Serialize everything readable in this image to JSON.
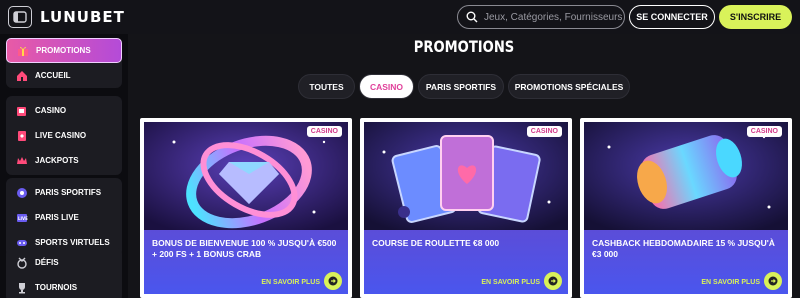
{
  "header": {
    "logo": "LUNUBET",
    "search_placeholder": "Jeux, Catégories, Fournisseurs",
    "login_label": "SE CONNECTER",
    "signup_label": "S'INSCRIRE",
    "colors": {
      "accent": "#d9f25a",
      "bg": "#131318"
    }
  },
  "sidebar": {
    "items": [
      {
        "label": "PROMOTIONS",
        "icon": "gift-icon",
        "active": true
      },
      {
        "label": "ACCUEIL",
        "icon": "home-icon"
      },
      {
        "label": "CASINO",
        "icon": "slot-icon"
      },
      {
        "label": "LIVE CASINO",
        "icon": "cards-icon"
      },
      {
        "label": "JACKPOTS",
        "icon": "crown-icon"
      },
      {
        "label": "PARIS SPORTIFS",
        "icon": "ball-icon"
      },
      {
        "label": "PARIS LIVE",
        "icon": "live-icon"
      },
      {
        "label": "SPORTS VIRTUELS",
        "icon": "virtual-icon"
      },
      {
        "label": "DÉFIS",
        "icon": "medal-icon"
      },
      {
        "label": "TOURNOIS",
        "icon": "trophy-icon"
      }
    ]
  },
  "main": {
    "title": "PROMOTIONS",
    "tabs": [
      {
        "label": "TOUTES",
        "active": false
      },
      {
        "label": "CASINO",
        "active": true
      },
      {
        "label": "PARIS SPORTIFS",
        "active": false
      },
      {
        "label": "PROMOTIONS SPÉCIALES",
        "active": false
      }
    ],
    "cards": [
      {
        "badge": "CASINO",
        "title": "BONUS DE BIENVENUE 100 % JUSQU'À €500 + 200 FS + 1 BONUS CRAB",
        "cta": "EN SAVOIR PLUS"
      },
      {
        "badge": "CASINO",
        "title": "COURSE DE ROULETTE €8 000",
        "cta": "EN SAVOIR PLUS"
      },
      {
        "badge": "CASINO",
        "title": "CASHBACK HEBDOMADAIRE 15 % JUSQU'À €3 000",
        "cta": "EN SAVOIR PLUS"
      }
    ]
  }
}
